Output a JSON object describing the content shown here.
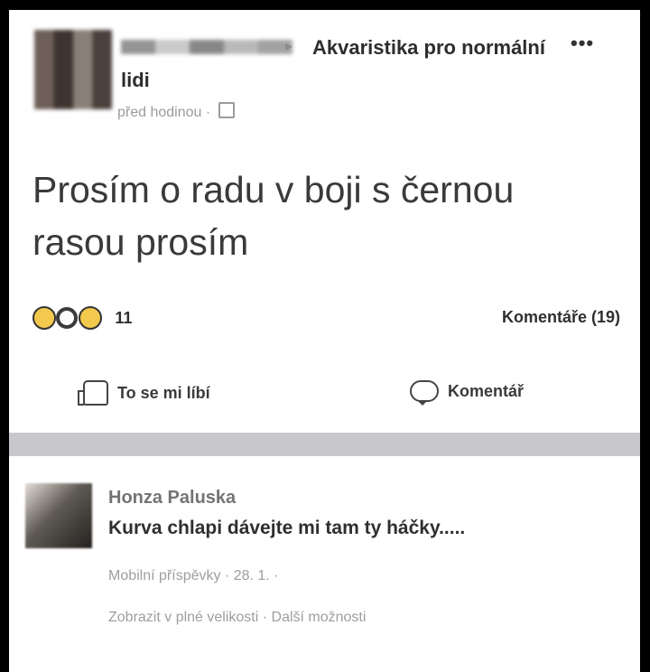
{
  "post": {
    "group": "Akvaristika pro normální lidi",
    "time": "před hodinou ·",
    "text": "Prosím o radu v boji s černou rasou prosím",
    "reaction_count": "11",
    "comments_label": "Komentáře (19)",
    "actions": {
      "like": "To se mi líbí",
      "comment": "Komentář"
    }
  },
  "comment": {
    "author": "Honza Paluska",
    "text": "Kurva chlapi dávejte mi tam ty háčky.....",
    "meta": "Mobilní příspěvky · 28. 1. ·",
    "actions": "Zobrazit v plné velikosti · Další možnosti"
  }
}
